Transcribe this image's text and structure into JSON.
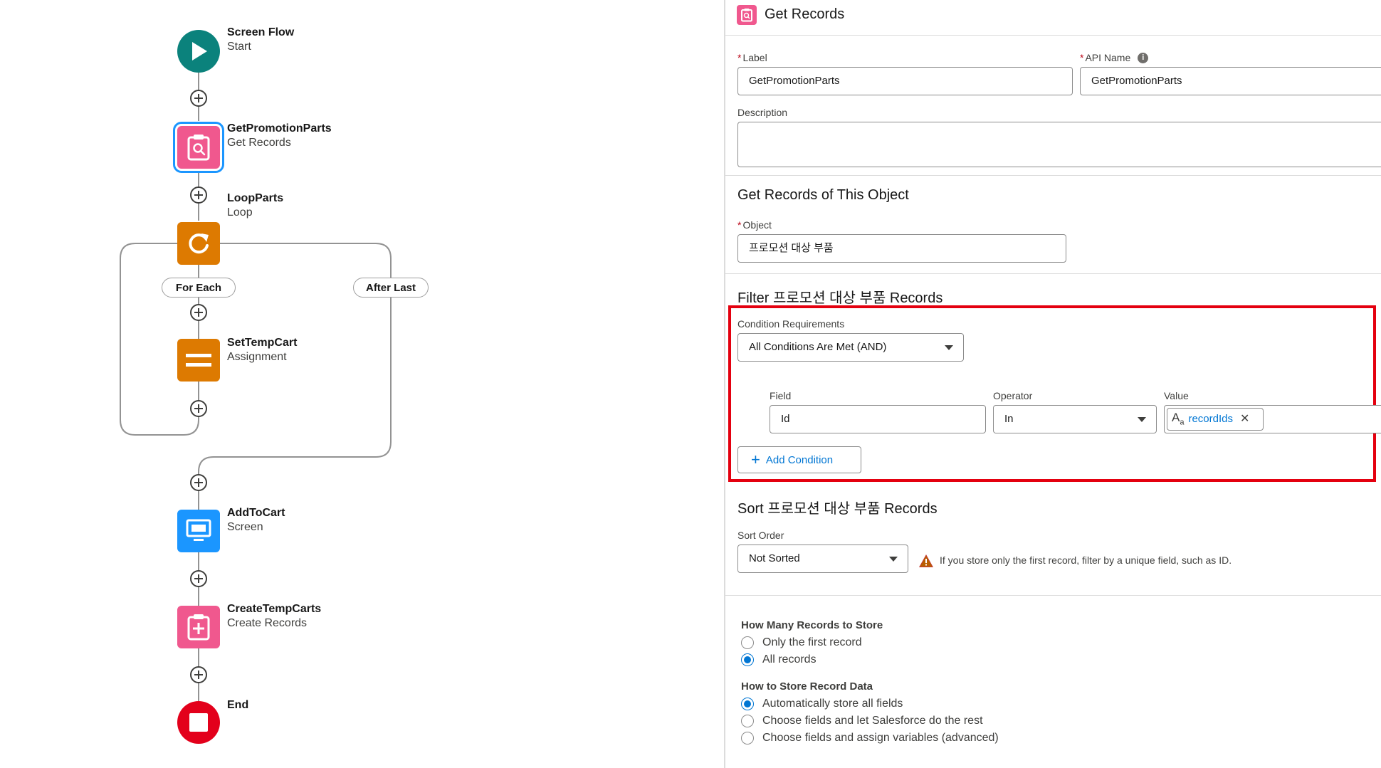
{
  "flow": {
    "start": {
      "title": "Screen Flow",
      "subtitle": "Start"
    },
    "get_records": {
      "title": "GetPromotionParts",
      "subtitle": "Get Records"
    },
    "loop": {
      "title": "LoopParts",
      "subtitle": "Loop"
    },
    "for_each_label": "For Each",
    "after_last_label": "After Last",
    "assignment": {
      "title": "SetTempCart",
      "subtitle": "Assignment"
    },
    "screen": {
      "title": "AddToCart",
      "subtitle": "Screen"
    },
    "create_records": {
      "title": "CreateTempCarts",
      "subtitle": "Create Records"
    },
    "end": {
      "title": "End"
    }
  },
  "panel": {
    "header_title": "Get Records",
    "label_field": {
      "label": "Label",
      "value": "GetPromotionParts"
    },
    "api_name_field": {
      "label": "API Name",
      "value": "GetPromotionParts"
    },
    "description_label": "Description",
    "object_section": {
      "title": "Get Records of This Object",
      "object_label": "Object",
      "object_value": "프로모션 대상 부품"
    },
    "filter_section": {
      "title": "Filter 프로모션 대상 부품 Records",
      "condition_requirements_label": "Condition Requirements",
      "condition_requirements_value": "All Conditions Are Met (AND)",
      "field_label": "Field",
      "field_value": "Id",
      "operator_label": "Operator",
      "operator_value": "In",
      "value_label": "Value",
      "value_pill": "recordIds",
      "add_condition_label": "Add Condition"
    },
    "sort_section": {
      "title": "Sort 프로모션 대상 부품 Records",
      "sort_order_label": "Sort Order",
      "sort_order_value": "Not Sorted",
      "warning_text": "If you store only the first record, filter by a unique field, such as ID."
    },
    "how_many": {
      "title": "How Many Records to Store",
      "options": [
        "Only the first record",
        "All records"
      ],
      "selected": 1
    },
    "how_store": {
      "title": "How to Store Record Data",
      "options": [
        "Automatically store all fields",
        "Choose fields and let Salesforce do the rest",
        "Choose fields and assign variables (advanced)"
      ],
      "selected": 0
    }
  },
  "colors": {
    "start_teal": "#0b827c",
    "record_pink": "#f0588e",
    "loop_orange": "#dd7a01",
    "screen_blue": "#1b96ff",
    "end_red": "#e3001b",
    "highlight_red": "#e4000f",
    "link_blue": "#0176d3"
  }
}
